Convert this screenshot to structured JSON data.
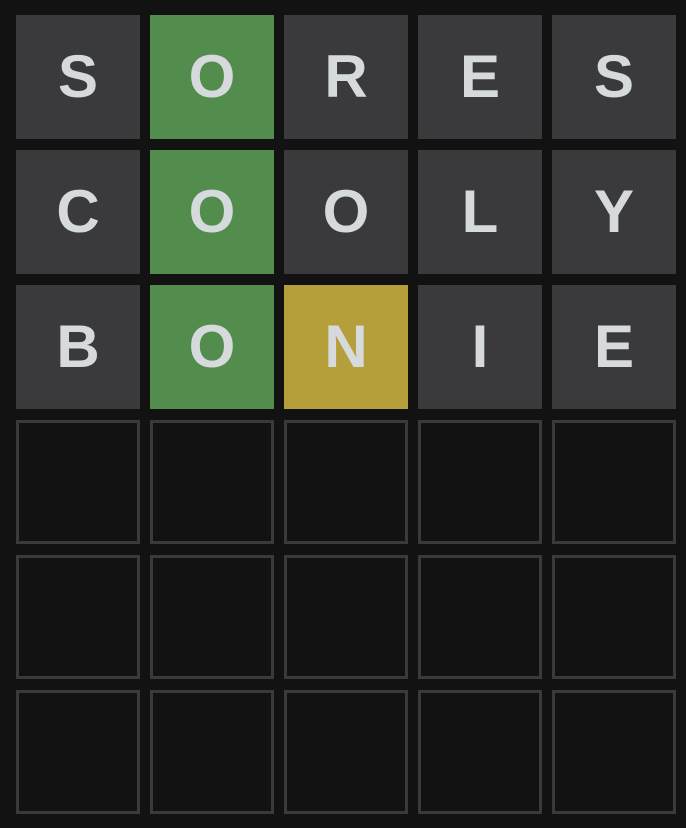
{
  "board": {
    "rows": [
      {
        "tiles": [
          {
            "letter": "S",
            "state": "absent"
          },
          {
            "letter": "O",
            "state": "correct"
          },
          {
            "letter": "R",
            "state": "absent"
          },
          {
            "letter": "E",
            "state": "absent"
          },
          {
            "letter": "S",
            "state": "absent"
          }
        ]
      },
      {
        "tiles": [
          {
            "letter": "C",
            "state": "absent"
          },
          {
            "letter": "O",
            "state": "correct"
          },
          {
            "letter": "O",
            "state": "absent"
          },
          {
            "letter": "L",
            "state": "absent"
          },
          {
            "letter": "Y",
            "state": "absent"
          }
        ]
      },
      {
        "tiles": [
          {
            "letter": "B",
            "state": "absent"
          },
          {
            "letter": "O",
            "state": "correct"
          },
          {
            "letter": "N",
            "state": "present"
          },
          {
            "letter": "I",
            "state": "absent"
          },
          {
            "letter": "E",
            "state": "absent"
          }
        ]
      },
      {
        "tiles": [
          {
            "letter": "",
            "state": "empty"
          },
          {
            "letter": "",
            "state": "empty"
          },
          {
            "letter": "",
            "state": "empty"
          },
          {
            "letter": "",
            "state": "empty"
          },
          {
            "letter": "",
            "state": "empty"
          }
        ]
      },
      {
        "tiles": [
          {
            "letter": "",
            "state": "empty"
          },
          {
            "letter": "",
            "state": "empty"
          },
          {
            "letter": "",
            "state": "empty"
          },
          {
            "letter": "",
            "state": "empty"
          },
          {
            "letter": "",
            "state": "empty"
          }
        ]
      },
      {
        "tiles": [
          {
            "letter": "",
            "state": "empty"
          },
          {
            "letter": "",
            "state": "empty"
          },
          {
            "letter": "",
            "state": "empty"
          },
          {
            "letter": "",
            "state": "empty"
          },
          {
            "letter": "",
            "state": "empty"
          }
        ]
      }
    ]
  },
  "colors": {
    "background": "#121213",
    "absent": "#3a3a3c",
    "correct": "#538d4e",
    "present": "#b59f3b",
    "empty_border": "#3a3a3c",
    "letter": "#d7dadc"
  }
}
